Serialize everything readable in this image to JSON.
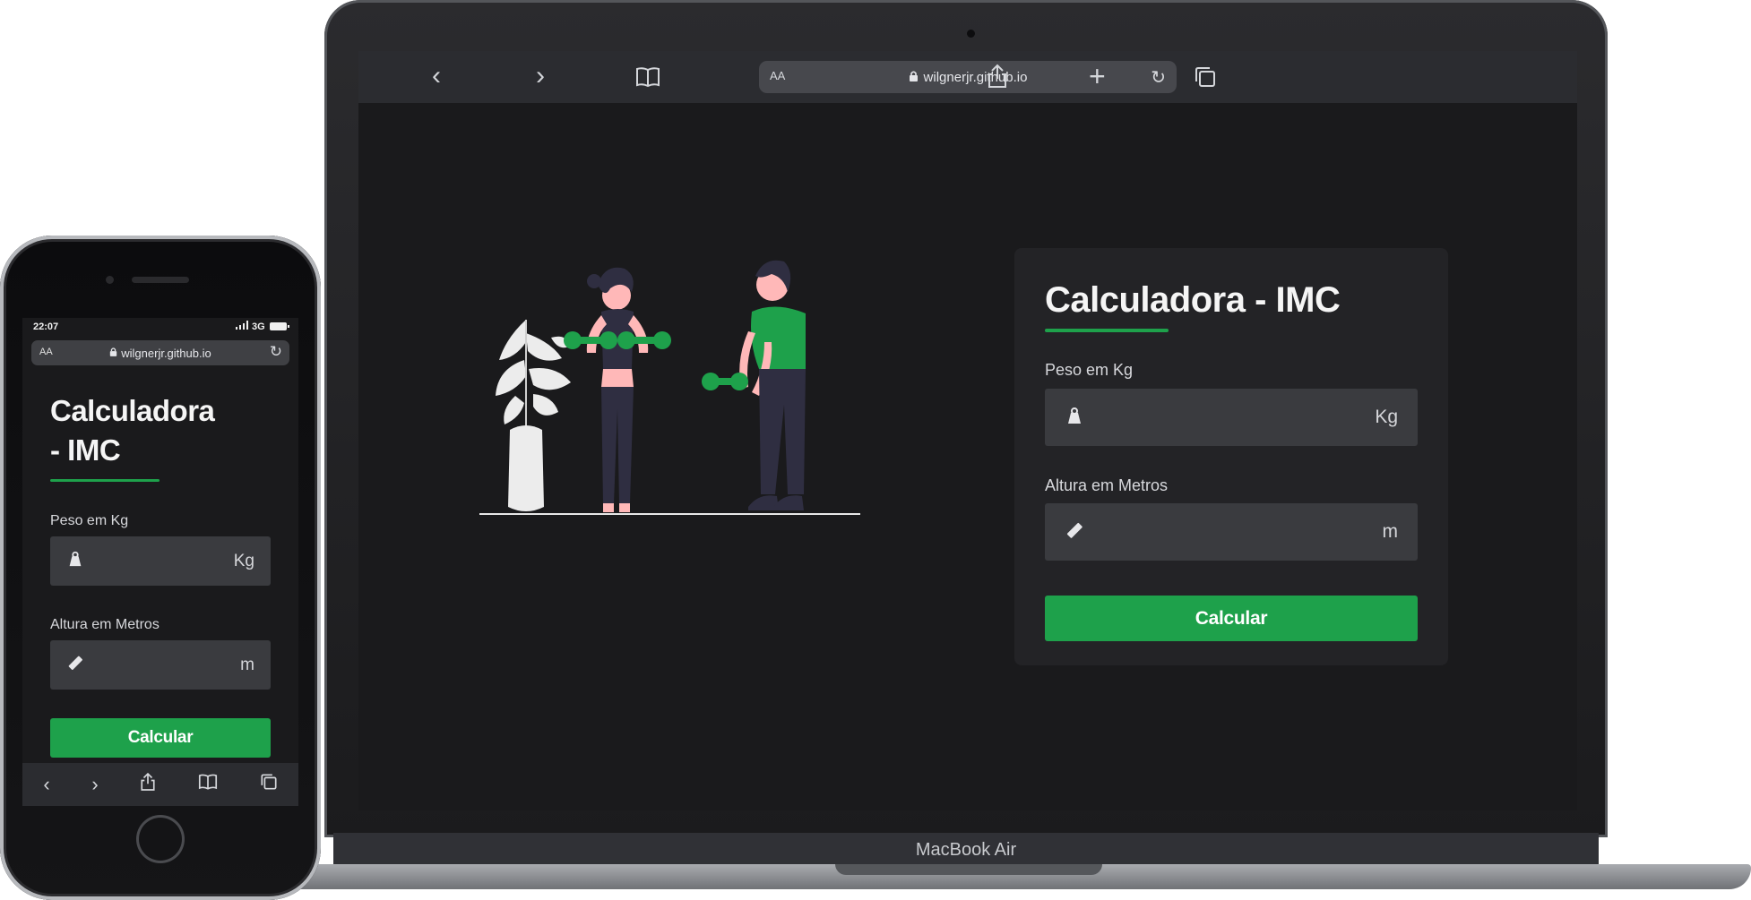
{
  "desktop": {
    "device_label": "MacBook Air",
    "url": "wilgnerjr.github.io",
    "url_prefix": "AA",
    "toolbar_icons": [
      "back-icon",
      "forward-icon",
      "bookmarks-icon",
      "share-icon",
      "new-tab-icon",
      "tabs-icon"
    ],
    "card": {
      "title": "Calculadora - IMC",
      "weight_label": "Peso em Kg",
      "weight_unit": "Kg",
      "weight_value": "",
      "height_label": "Altura em Metros",
      "height_unit": "m",
      "height_value": "",
      "button_label": "Calcular"
    }
  },
  "mobile": {
    "status_time": "22:07",
    "status_network": "3G",
    "url": "wilgnerjr.github.io",
    "url_prefix": "AA",
    "title_line1": "Calculadora",
    "title_line2": "- IMC",
    "weight_label": "Peso em Kg",
    "weight_unit": "Kg",
    "weight_value": "",
    "height_label": "Altura em Metros",
    "height_unit": "m",
    "height_value": "",
    "button_label": "Calcular"
  },
  "colors": {
    "accent": "#1ea14b",
    "background": "#1a1a1c",
    "card": "#232326",
    "input": "#3a3b3f"
  }
}
